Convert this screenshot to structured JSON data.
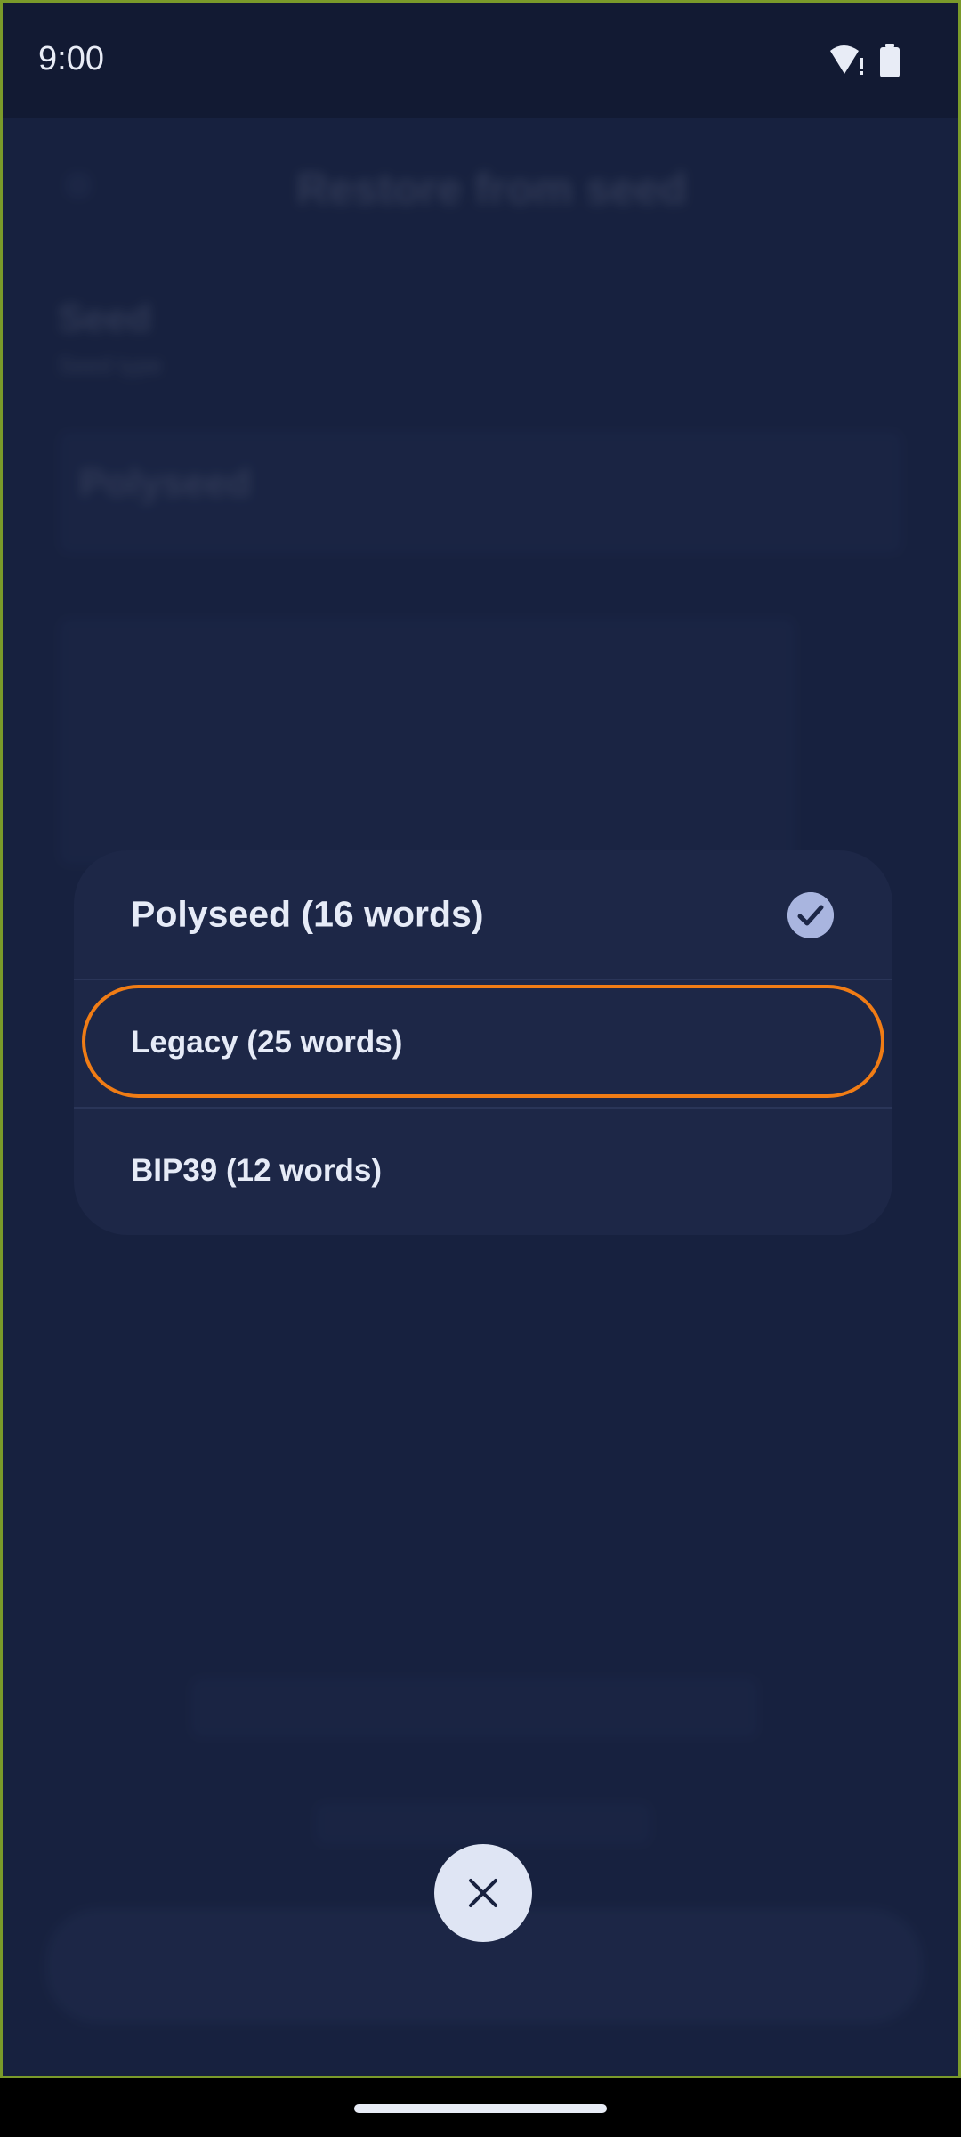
{
  "status_bar": {
    "time": "9:00"
  },
  "background": {
    "title": "Restore from seed",
    "field_label": "Seed",
    "field_sub": "Seed type",
    "selected_type": "Polyseed"
  },
  "seed_type_sheet": {
    "options": [
      {
        "label": "Polyseed (16 words)",
        "selected": true
      },
      {
        "label": "Legacy (25 words)",
        "selected": false
      },
      {
        "label": "BIP39 (12 words)",
        "selected": false
      }
    ]
  },
  "icons": {
    "check": "check-circle-icon",
    "close": "close-icon",
    "wifi": "wifi-alert-icon",
    "battery": "battery-icon"
  },
  "colors": {
    "background": "#18213f",
    "sheet": "#1d2747",
    "highlight": "#f07c15",
    "check": "#a9b5df"
  }
}
